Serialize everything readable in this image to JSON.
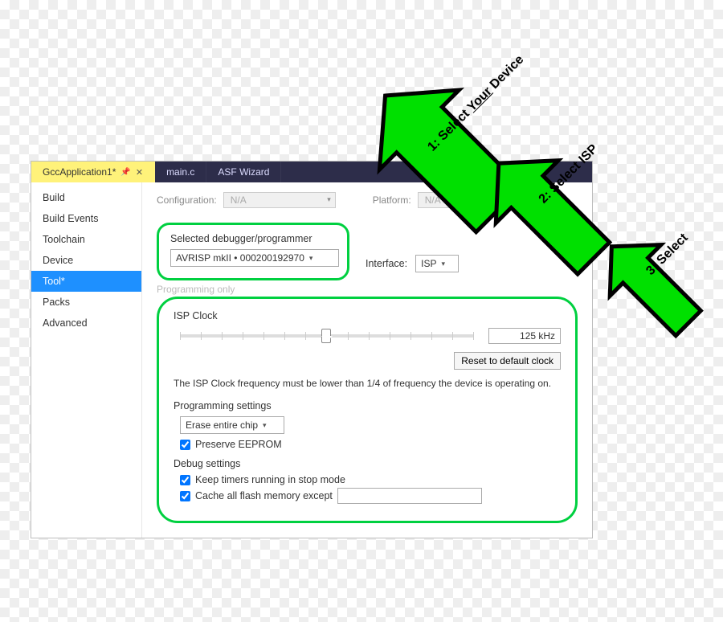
{
  "tabs": [
    {
      "label": "GccApplication1*"
    },
    {
      "label": "main.c"
    },
    {
      "label": "ASF Wizard"
    }
  ],
  "sidebar": {
    "items": [
      {
        "label": "Build"
      },
      {
        "label": "Build Events"
      },
      {
        "label": "Toolchain"
      },
      {
        "label": "Device"
      },
      {
        "label": "Tool*"
      },
      {
        "label": "Packs"
      },
      {
        "label": "Advanced"
      }
    ]
  },
  "config_row": {
    "configuration_label": "Configuration:",
    "configuration_value": "N/A",
    "platform_label": "Platform:",
    "platform_value": "N/A"
  },
  "programmer": {
    "group_label": "Selected debugger/programmer",
    "value": "AVRISP mkII • 000200192970",
    "interface_label": "Interface:",
    "interface_value": "ISP"
  },
  "sub_caption": "Programming only",
  "isp": {
    "title": "ISP Clock",
    "clock_value": "125 kHz",
    "reset_button": "Reset to default clock",
    "note": "The ISP Clock frequency must be lower than 1/4 of frequency the device is operating on."
  },
  "programming_settings": {
    "title": "Programming settings",
    "erase_value": "Erase entire chip",
    "preserve_label": "Preserve EEPROM"
  },
  "debug_settings": {
    "title": "Debug settings",
    "keep_timers_label": "Keep timers running in stop mode",
    "cache_flash_label": "Cache all flash memory except",
    "cache_flash_value": ""
  },
  "annotations": {
    "a1_prefix": "1: Select ",
    "a1_underlined": "Your",
    "a1_suffix": " Device",
    "a2": "2: Select ISP",
    "a3": "3: Select"
  }
}
